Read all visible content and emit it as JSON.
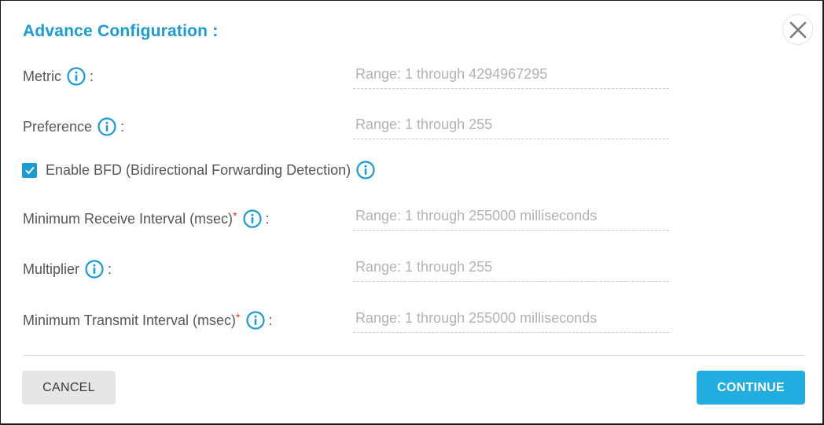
{
  "dialog": {
    "title": "Advance Configuration :",
    "close_icon": "close-icon"
  },
  "fields": [
    {
      "label": "Metric",
      "required": false,
      "colon": ":",
      "value": "",
      "placeholder": "Range: 1 through 4294967295"
    },
    {
      "label": "Preference",
      "required": false,
      "colon": ":",
      "value": "",
      "placeholder": "Range: 1 through 255"
    },
    {
      "label": "Minimum Receive Interval (msec)",
      "required": true,
      "required_mark": "*",
      "colon": ":",
      "value": "",
      "placeholder": "Range: 1 through 255000 milliseconds"
    },
    {
      "label": "Multiplier",
      "required": false,
      "colon": ":",
      "value": "",
      "placeholder": "Range: 1 through 255"
    },
    {
      "label": "Minimum Transmit Interval (msec)",
      "required": true,
      "required_mark": "*",
      "colon": ":",
      "value": "",
      "placeholder": "Range: 1 through 255000 milliseconds"
    }
  ],
  "bfd": {
    "label": "Enable BFD (Bidirectional Forwarding Detection)",
    "checked": true
  },
  "footer": {
    "cancel_label": "CANCEL",
    "continue_label": "CONTINUE"
  },
  "colors": {
    "accent": "#1a9ad6",
    "primary_button": "#22ade0",
    "required": "#e0302c"
  }
}
